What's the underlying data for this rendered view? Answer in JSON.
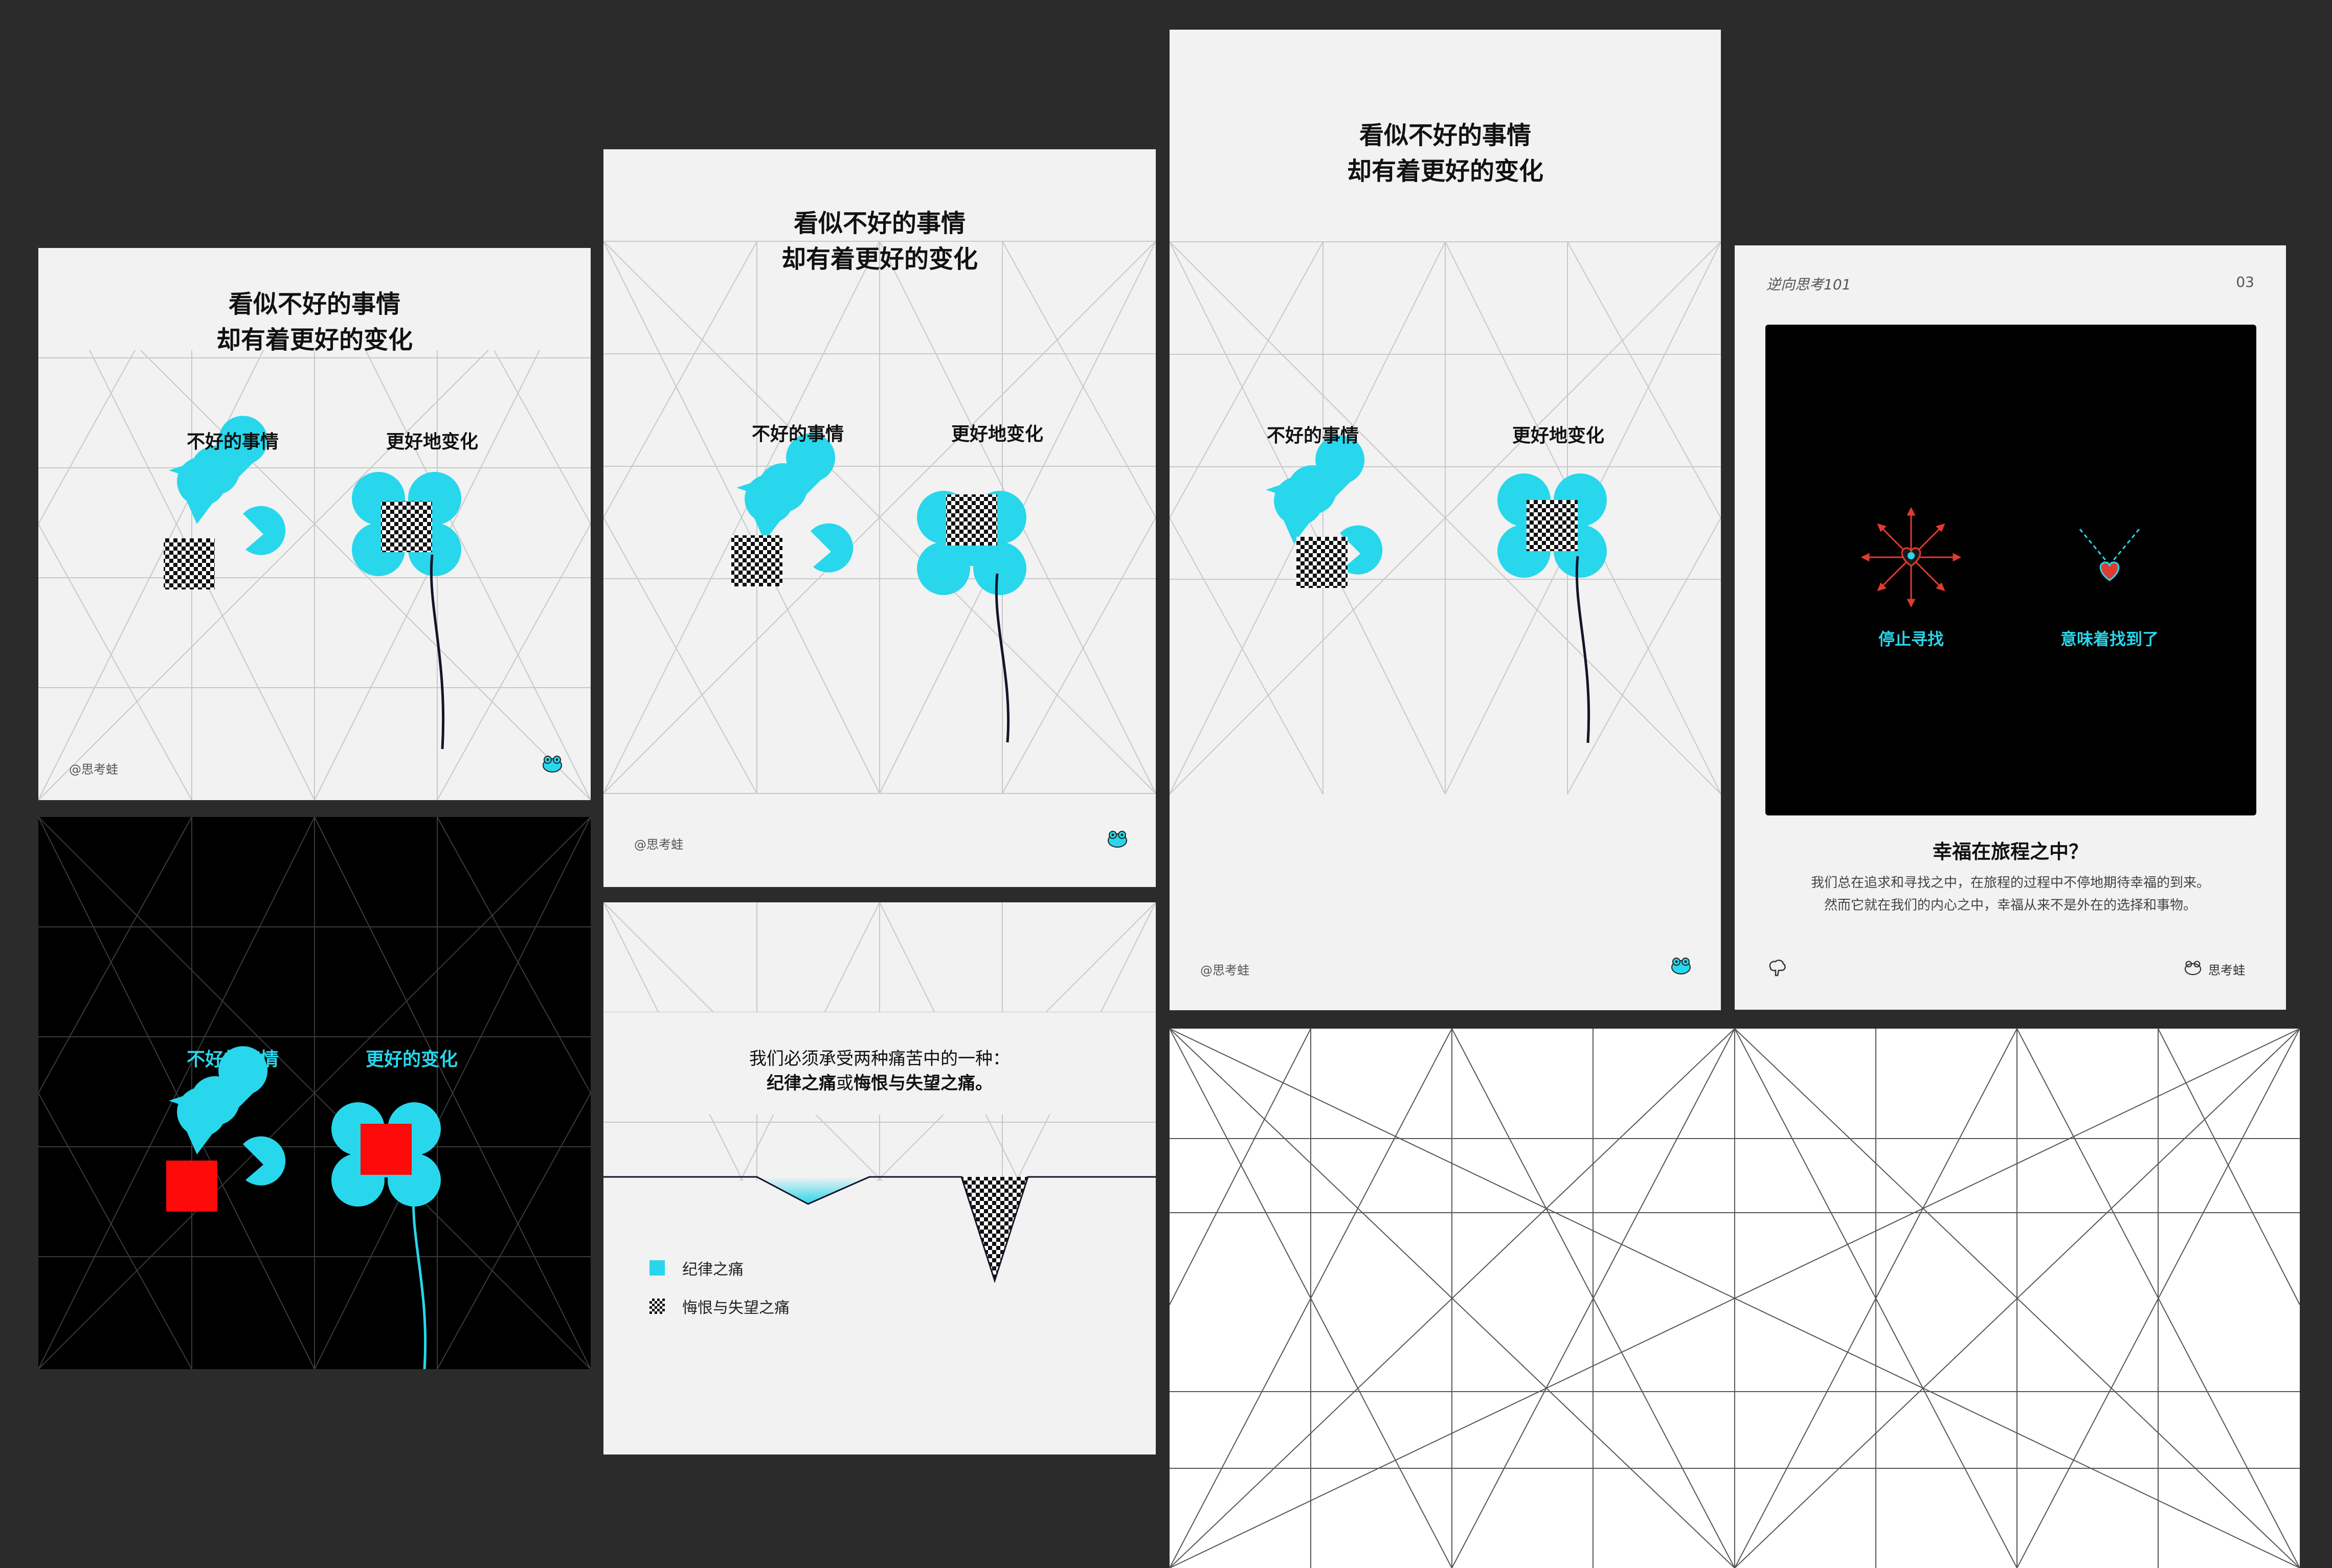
{
  "colors": {
    "background": "#2b2b2b",
    "cyan": "#28d7ec",
    "red": "#ff0a0a",
    "light_card": "#f2f2f2",
    "grid_line": "#c4c4c4",
    "dark_text": "#111111",
    "meta_text": "#555555"
  },
  "poster": {
    "title_line1": "看似不好的事情",
    "title_line2": "却有着更好的变化",
    "label_left": "不好的事情",
    "label_right": "更好地变化",
    "handle": "@思考蛙",
    "logo_icon": "frog-icon"
  },
  "dark_card": {
    "label_left": "不好的事情",
    "label_right": "更好的变化"
  },
  "pain_card": {
    "line1": "我们必须承受两种痛苦中的一种：",
    "line2_a": "纪律之痛",
    "line2_b": "或",
    "line2_c": "悔恨与失望之痛。",
    "legend": [
      {
        "label": "纪律之痛",
        "swatch": "cyan"
      },
      {
        "label": "悔恨与失望之痛",
        "swatch": "checker"
      }
    ]
  },
  "happiness_card": {
    "series": "逆向思考101",
    "page_number": "03",
    "label_left": "停止寻找",
    "label_right": "意味着找到了",
    "title": "幸福在旅程之中？",
    "body_line1": "我们总在追求和寻找之中，在旅程的过程中不停地期待幸福的到来。",
    "body_line2": "然而它就在我们的内心之中，幸福从来不是外在的选择和事物。",
    "brand": "思考蛙",
    "left_icon": "brain-icon",
    "brand_icon": "frog-icon"
  }
}
